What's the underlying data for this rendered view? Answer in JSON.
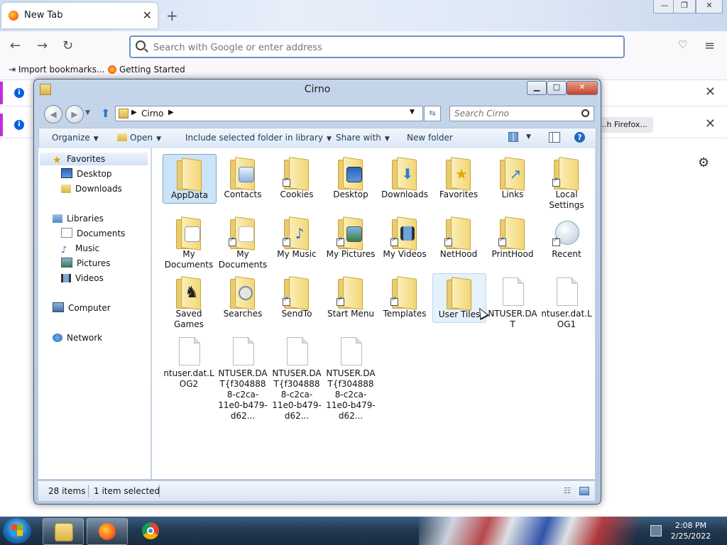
{
  "browser": {
    "tab_title": "New Tab",
    "url_placeholder": "Search with Google or enter address",
    "bookmarks": [
      "Import bookmarks...",
      "Getting Started"
    ],
    "notifications": [
      {
        "text": "",
        "button": ""
      },
      {
        "text": "",
        "button": "...h Firefox..."
      }
    ]
  },
  "explorer": {
    "title": "Cirno",
    "breadcrumb": "Cirno",
    "search_placeholder": "Search Cirno",
    "toolbar": {
      "organize": "Organize",
      "open": "Open",
      "include": "Include selected folder in library",
      "share": "Share with",
      "new_folder": "New folder"
    },
    "nav": {
      "favorites": "Favorites",
      "desktop": "Desktop",
      "downloads": "Downloads",
      "libraries": "Libraries",
      "documents": "Documents",
      "music": "Music",
      "pictures": "Pictures",
      "videos": "Videos",
      "computer": "Computer",
      "network": "Network"
    },
    "files": [
      {
        "name": "AppData",
        "type": "folder"
      },
      {
        "name": "Contacts",
        "type": "folder"
      },
      {
        "name": "Cookies",
        "type": "folder"
      },
      {
        "name": "Desktop",
        "type": "folder"
      },
      {
        "name": "Downloads",
        "type": "folder"
      },
      {
        "name": "Favorites",
        "type": "folder"
      },
      {
        "name": "Links",
        "type": "folder"
      },
      {
        "name": "Local Settings",
        "type": "folder"
      },
      {
        "name": "My Documents",
        "type": "folder"
      },
      {
        "name": "My Documents",
        "type": "folder"
      },
      {
        "name": "My Music",
        "type": "folder"
      },
      {
        "name": "My Pictures",
        "type": "folder"
      },
      {
        "name": "My Videos",
        "type": "folder"
      },
      {
        "name": "NetHood",
        "type": "folder"
      },
      {
        "name": "PrintHood",
        "type": "folder"
      },
      {
        "name": "Recent",
        "type": "folder"
      },
      {
        "name": "Saved Games",
        "type": "folder"
      },
      {
        "name": "Searches",
        "type": "folder"
      },
      {
        "name": "SendTo",
        "type": "folder"
      },
      {
        "name": "Start Menu",
        "type": "folder"
      },
      {
        "name": "Templates",
        "type": "folder"
      },
      {
        "name": "User Tiles",
        "type": "folder"
      },
      {
        "name": "NTUSER.DAT",
        "type": "file"
      },
      {
        "name": "ntuser.dat.LOG1",
        "type": "file"
      },
      {
        "name": "ntuser.dat.LOG2",
        "type": "file"
      },
      {
        "name": "NTUSER.DAT{f3048888-c2ca-11e0-b479-d62...",
        "type": "file"
      },
      {
        "name": "NTUSER.DAT{f3048888-c2ca-11e0-b479-d62...",
        "type": "file"
      },
      {
        "name": "NTUSER.DAT{f3048888-c2ca-11e0-b479-d62...",
        "type": "file"
      }
    ],
    "status": {
      "count": "28 items",
      "selected": "1 item selected"
    }
  },
  "taskbar": {
    "time": "2:08 PM",
    "date": "2/25/2022"
  }
}
